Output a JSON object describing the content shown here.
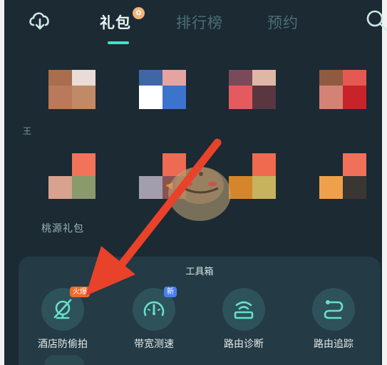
{
  "header": {
    "tabs": [
      {
        "label": "礼包",
        "active": true
      },
      {
        "label": "排行榜",
        "active": false
      },
      {
        "label": "预约",
        "active": false
      }
    ],
    "tab_badge": "✿",
    "upload_icon": "cloud-download-icon",
    "search_icon": "search-icon"
  },
  "gifts": {
    "side_char": "王",
    "label": "桃源礼包"
  },
  "toolbox": {
    "title": "工具箱",
    "tools": [
      {
        "label": "酒店防偷拍",
        "badge": "火爆",
        "icon": "camera-off-icon"
      },
      {
        "label": "带宽测速",
        "badge": "新",
        "icon": "speedometer-icon"
      },
      {
        "label": "路由诊断",
        "badge": "",
        "icon": "router-icon"
      },
      {
        "label": "路由追踪",
        "badge": "",
        "icon": "route-trace-icon"
      }
    ]
  },
  "colors": {
    "background": "#1b2a33",
    "accent": "#3fe0c6",
    "arrow": "#e8422a",
    "tool_bg": "#243a44"
  }
}
